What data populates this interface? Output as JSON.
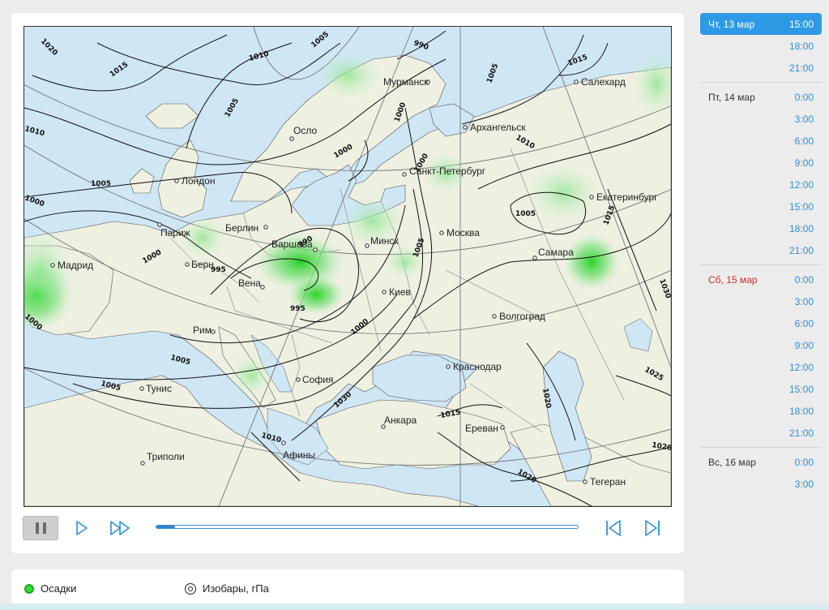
{
  "map": {
    "cities": [
      {
        "name": "Мурманск"
      },
      {
        "name": "Салехард"
      },
      {
        "name": "Осло"
      },
      {
        "name": "Архангельск"
      },
      {
        "name": "Лондон"
      },
      {
        "name": "Санкт-Петербург"
      },
      {
        "name": "Екатеринбург"
      },
      {
        "name": "Берлин"
      },
      {
        "name": "Париж"
      },
      {
        "name": "Варшава"
      },
      {
        "name": "Минск"
      },
      {
        "name": "Москва"
      },
      {
        "name": "Мадрид"
      },
      {
        "name": "Берн"
      },
      {
        "name": "Вена"
      },
      {
        "name": "Самара"
      },
      {
        "name": "Киев"
      },
      {
        "name": "Волгоград"
      },
      {
        "name": "Рим"
      },
      {
        "name": "Краснодар"
      },
      {
        "name": "Тунис"
      },
      {
        "name": "София"
      },
      {
        "name": "Анкара"
      },
      {
        "name": "Ереван"
      },
      {
        "name": "Афины"
      },
      {
        "name": "Триполи"
      },
      {
        "name": "Тегеран"
      }
    ],
    "isobar_labels": [
      "1020",
      "1015",
      "1010",
      "1005",
      "1000",
      "995",
      "990",
      "1025",
      "1030"
    ]
  },
  "controls": {
    "progress": 0.045
  },
  "legend": {
    "precip_label": "Осадки",
    "isobar_label": "Изобары, гПа"
  },
  "timeline": [
    {
      "day": "Чт, 13 мар",
      "weekend": false,
      "times": [
        "15:00",
        "18:00",
        "21:00"
      ],
      "active_index": 0
    },
    {
      "day": "Пт, 14 мар",
      "weekend": false,
      "times": [
        "0:00",
        "3:00",
        "6:00",
        "9:00",
        "12:00",
        "15:00",
        "18:00",
        "21:00"
      ]
    },
    {
      "day": "Сб, 15 мар",
      "weekend": true,
      "times": [
        "0:00",
        "3:00",
        "6:00",
        "9:00",
        "12:00",
        "15:00",
        "18:00",
        "21:00"
      ]
    },
    {
      "day": "Вс, 16 мар",
      "weekend": false,
      "times": [
        "0:00",
        "3:00"
      ]
    }
  ],
  "colors": {
    "accent": "#2e9ae6",
    "weekend": "#cc2b2b",
    "precip": "#33dd33",
    "sea": "#cfe6f5",
    "land": "#eef0e2"
  }
}
